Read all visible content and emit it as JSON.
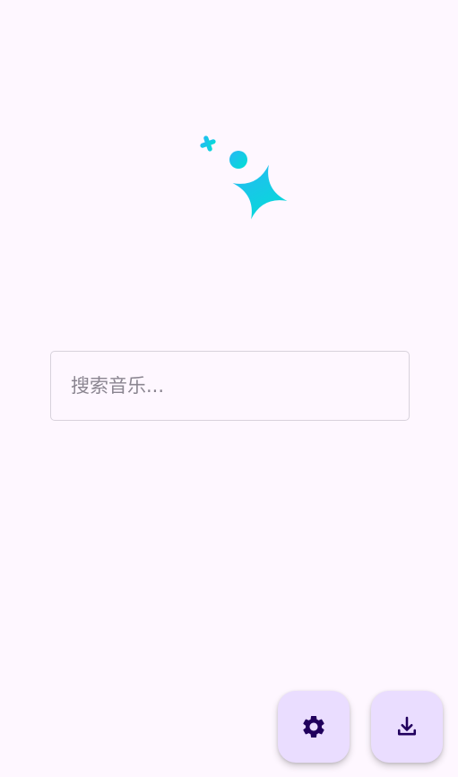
{
  "search": {
    "placeholder": "搜索音乐...",
    "value": ""
  },
  "logo": {
    "icon": "sparkle-icon",
    "gradient_start": "#29b6f6",
    "gradient_end": "#00e0d3"
  },
  "fabs": {
    "settings": {
      "icon": "gear-icon"
    },
    "download": {
      "icon": "download-icon"
    }
  },
  "colors": {
    "background": "#fef7ff",
    "fab_background": "#eaddff",
    "fab_icon": "#21005d",
    "field_border": "#d8d2dc",
    "placeholder_text": "#8a8590"
  }
}
